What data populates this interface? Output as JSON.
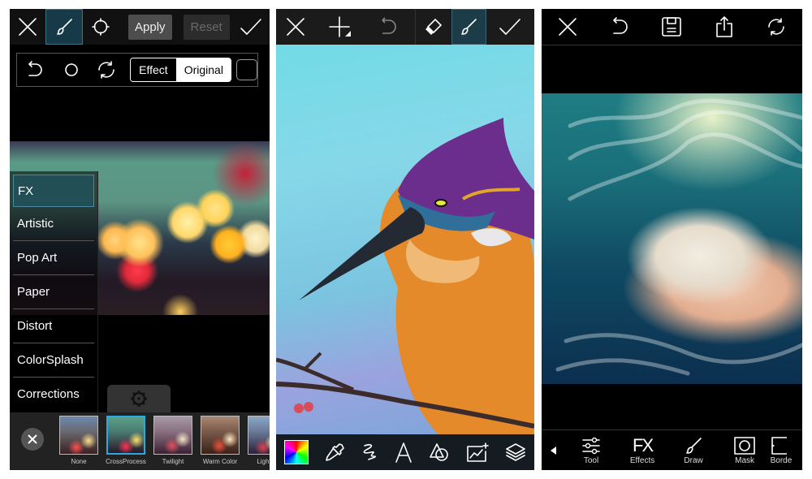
{
  "panel_effects": {
    "toolbar": {
      "close_icon": "close-icon",
      "brush_icon": "brush-icon",
      "circle_icon": "circle-icon",
      "apply_label": "Apply",
      "reset_label": "Reset",
      "confirm_icon": "checkmark-icon"
    },
    "subtoolbar": {
      "undo_icon": "undo-icon",
      "circle_icon": "circle-icon",
      "refresh_icon": "refresh-icon",
      "effect_label": "Effect",
      "original_label": "Original",
      "selected_mode": "Original"
    },
    "categories": [
      {
        "label": "FX",
        "active": true
      },
      {
        "label": "Artistic"
      },
      {
        "label": "Pop Art"
      },
      {
        "label": "Paper"
      },
      {
        "label": "Distort"
      },
      {
        "label": "ColorSplash"
      },
      {
        "label": "Corrections"
      }
    ],
    "settings_icon": "gear-icon",
    "filters": [
      {
        "label": "None"
      },
      {
        "label": "CrossProcess",
        "selected": true
      },
      {
        "label": "Twilight"
      },
      {
        "label": "Warm Color"
      },
      {
        "label": "Light C"
      }
    ]
  },
  "panel_draw": {
    "toolbar": {
      "close_icon": "close-icon",
      "add_layer_icon": "plus-icon",
      "undo_icon": "undo-icon",
      "eraser_icon": "eraser-icon",
      "brush_icon": "brush-icon",
      "confirm_icon": "checkmark-icon"
    },
    "bottom_tools": [
      "color-picker",
      "eyedropper",
      "brush-style",
      "text",
      "shapes",
      "add-photo",
      "layers"
    ]
  },
  "panel_editor": {
    "toolbar": {
      "close_icon": "close-icon",
      "undo_icon": "undo-icon",
      "save_icon": "save-icon",
      "share_icon": "share-icon",
      "refresh_icon": "refresh-icon"
    },
    "tools": [
      {
        "label": "Tool",
        "icon": "sliders-icon"
      },
      {
        "label": "Effects",
        "icon": "fx-icon",
        "glyph": "FX"
      },
      {
        "label": "Draw",
        "icon": "brush-icon"
      },
      {
        "label": "Mask",
        "icon": "mask-icon"
      },
      {
        "label": "Borde",
        "icon": "border-icon"
      }
    ]
  }
}
